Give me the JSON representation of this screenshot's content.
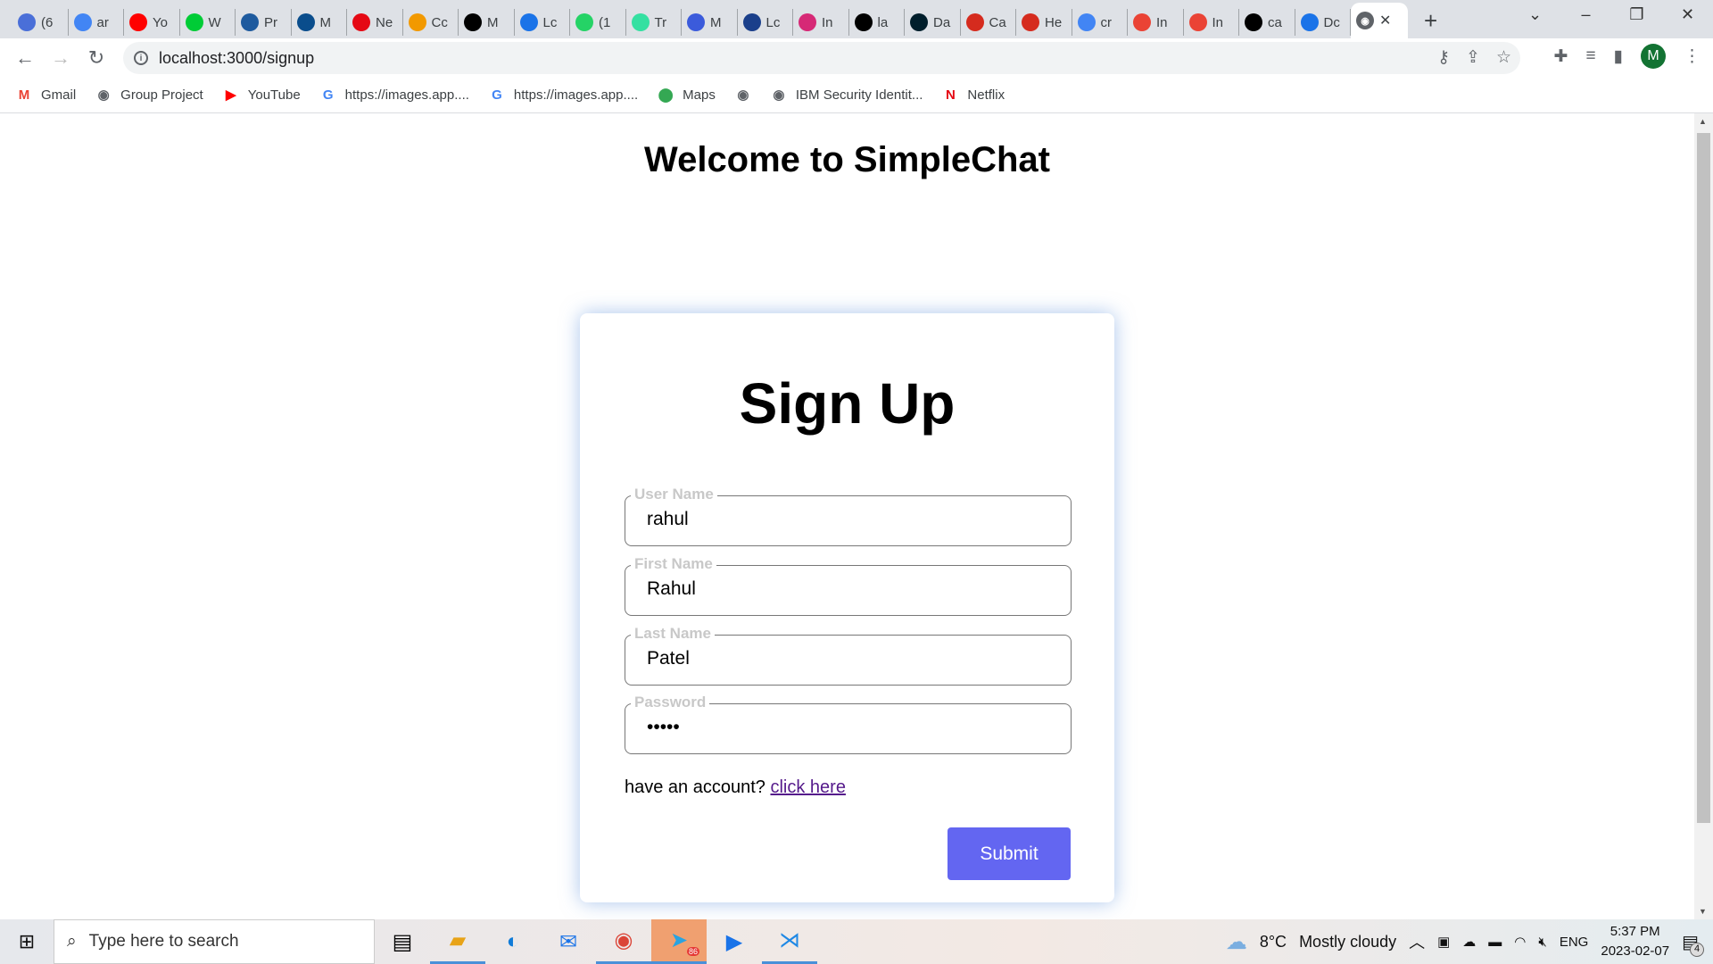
{
  "browser": {
    "tabs": [
      {
        "label": "(6",
        "icon": "badge-6-icon",
        "color": "#4a6fd8"
      },
      {
        "label": "ar",
        "icon": "google-icon",
        "color": "#4285f4"
      },
      {
        "label": "Yo",
        "icon": "youtube-icon",
        "color": "#ff0000"
      },
      {
        "label": "W",
        "icon": "iqiyi-icon",
        "color": "#00cc36"
      },
      {
        "label": "Pr",
        "icon": "play-icon",
        "color": "#1e5a9e"
      },
      {
        "label": "M",
        "icon": "mdl-icon",
        "color": "#0a4d8c"
      },
      {
        "label": "Ne",
        "icon": "netflix-icon",
        "color": "#e50914"
      },
      {
        "label": "Cc",
        "icon": "pencil-icon",
        "color": "#f29900"
      },
      {
        "label": "M",
        "icon": "blackboard-icon",
        "color": "#000000"
      },
      {
        "label": "Lc",
        "icon": "loop-icon",
        "color": "#1a73e8"
      },
      {
        "label": "(1",
        "icon": "whatsapp-icon",
        "color": "#25d366"
      },
      {
        "label": "Tr",
        "icon": "tripadvisor-icon",
        "color": "#34e0a1"
      },
      {
        "label": "M",
        "icon": "a-icon",
        "color": "#3b5bdb"
      },
      {
        "label": "Lc",
        "icon": "cbc-icon",
        "color": "#1a3f8b"
      },
      {
        "label": "In",
        "icon": "instagram-icon",
        "color": "#d62976"
      },
      {
        "label": "la",
        "icon": "github-icon",
        "color": "#000000"
      },
      {
        "label": "Da",
        "icon": "mongodb-icon",
        "color": "#001e2b"
      },
      {
        "label": "Ca",
        "icon": "maple-leaf-icon",
        "color": "#d52b1e"
      },
      {
        "label": "He",
        "icon": "maple-leaf-icon",
        "color": "#d52b1e"
      },
      {
        "label": "cr",
        "icon": "google-icon",
        "color": "#4285f4"
      },
      {
        "label": "In",
        "icon": "gmail-icon",
        "color": "#ea4335"
      },
      {
        "label": "In",
        "icon": "gmail-icon",
        "color": "#ea4335"
      },
      {
        "label": "ca",
        "icon": "github-icon",
        "color": "#000000"
      },
      {
        "label": "Dc",
        "icon": "download-icon",
        "color": "#1a73e8"
      }
    ],
    "active_tab": {
      "label": "",
      "icon": "globe-icon"
    },
    "new_tab": "+",
    "url": "localhost:3000/signup",
    "profile_initial": "M",
    "bookmarks": [
      {
        "label": "Gmail",
        "icon": "gmail-icon",
        "glyph": "M",
        "color": "#ea4335"
      },
      {
        "label": "Group Project",
        "icon": "globe-icon",
        "glyph": "◉",
        "color": "#5f6368"
      },
      {
        "label": "YouTube",
        "icon": "youtube-icon",
        "glyph": "▶",
        "color": "#ff0000"
      },
      {
        "label": "https://images.app....",
        "icon": "google-icon",
        "glyph": "G",
        "color": "#4285f4"
      },
      {
        "label": "https://images.app....",
        "icon": "google-icon",
        "glyph": "G",
        "color": "#4285f4"
      },
      {
        "label": "Maps",
        "icon": "maps-pin-icon",
        "glyph": "⬤",
        "color": "#34a853"
      },
      {
        "label": "",
        "icon": "globe-icon",
        "glyph": "◉",
        "color": "#5f6368"
      },
      {
        "label": "IBM Security Identit...",
        "icon": "globe-icon",
        "glyph": "◉",
        "color": "#5f6368"
      },
      {
        "label": "Netflix",
        "icon": "netflix-icon",
        "glyph": "N",
        "color": "#e50914"
      }
    ]
  },
  "page": {
    "title": "Welcome to SimpleChat",
    "form": {
      "heading": "Sign Up",
      "fields": [
        {
          "label": "User Name",
          "value": "rahul",
          "type": "text"
        },
        {
          "label": "First Name",
          "value": "Rahul",
          "type": "text"
        },
        {
          "label": "Last Name",
          "value": "Patel",
          "type": "text"
        },
        {
          "label": "Password",
          "value": "•••••",
          "type": "password"
        }
      ],
      "account_text": "have an account?",
      "account_link": "click here",
      "submit": "Submit",
      "submit_color": "#6366f1"
    }
  },
  "taskbar": {
    "search_placeholder": "Type here to search",
    "weather_temp": "8°C",
    "weather_desc": "Mostly cloudy",
    "language": "ENG",
    "time": "5:37 PM",
    "date": "2023-02-07",
    "notifications": "4",
    "telegram_badge": "86"
  }
}
